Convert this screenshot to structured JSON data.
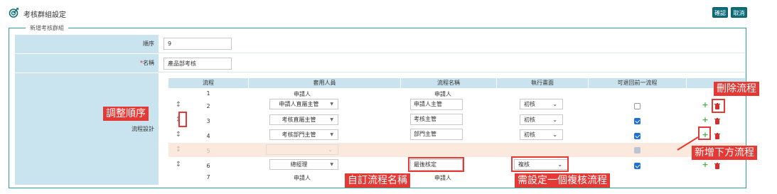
{
  "header": {
    "title": "考核群組設定",
    "confirm_label": "確認",
    "cancel_label": "取消"
  },
  "form": {
    "legend": "新增考核群組",
    "order_label": "順序",
    "order_value": "9",
    "name_required": "*",
    "name_label": "名稱",
    "name_value": "產品部考核",
    "flow_label": "流程設計"
  },
  "flow_table": {
    "headers": [
      "流程",
      "套用人員",
      "流程名稱",
      "執行畫面",
      "可退回前一流程"
    ],
    "rows": [
      {
        "no": "1",
        "person": "申請人",
        "name": "申請人"
      },
      {
        "no": "2",
        "person": "申請人直屬主管",
        "name": "申請人主管",
        "screen": "初核",
        "can_return": false
      },
      {
        "no": "3",
        "person": "考核直屬主管",
        "name": "考核主管",
        "screen": "初核",
        "can_return": true
      },
      {
        "no": "4",
        "person": "考核部門主管",
        "name": "部門主管",
        "screen": "初核",
        "can_return": true
      },
      {
        "no": "5",
        "person": "",
        "name": "",
        "screen": "",
        "can_return": true,
        "disabled": true
      },
      {
        "no": "6",
        "person": "總經理",
        "name": "最後核定",
        "screen": "複核",
        "can_return": true
      },
      {
        "no": "7",
        "person": "申請人",
        "name": "申請人"
      }
    ]
  },
  "annotations": {
    "delete_flow": "刪除流程",
    "adjust_order": "調整順序",
    "add_below": "新增下方流程",
    "custom_name": "自訂流程名稱",
    "set_review": "需設定一個複核流程"
  },
  "colors": {
    "accent": "#0d6e7a",
    "label_bg": "#c9e3ef",
    "annotation": "#e53935",
    "border": "#26a69a"
  },
  "icons": [
    "target-icon",
    "drag-handle-icon",
    "plus-icon",
    "trash-icon",
    "chevron-down-icon",
    "caret-down-icon"
  ]
}
